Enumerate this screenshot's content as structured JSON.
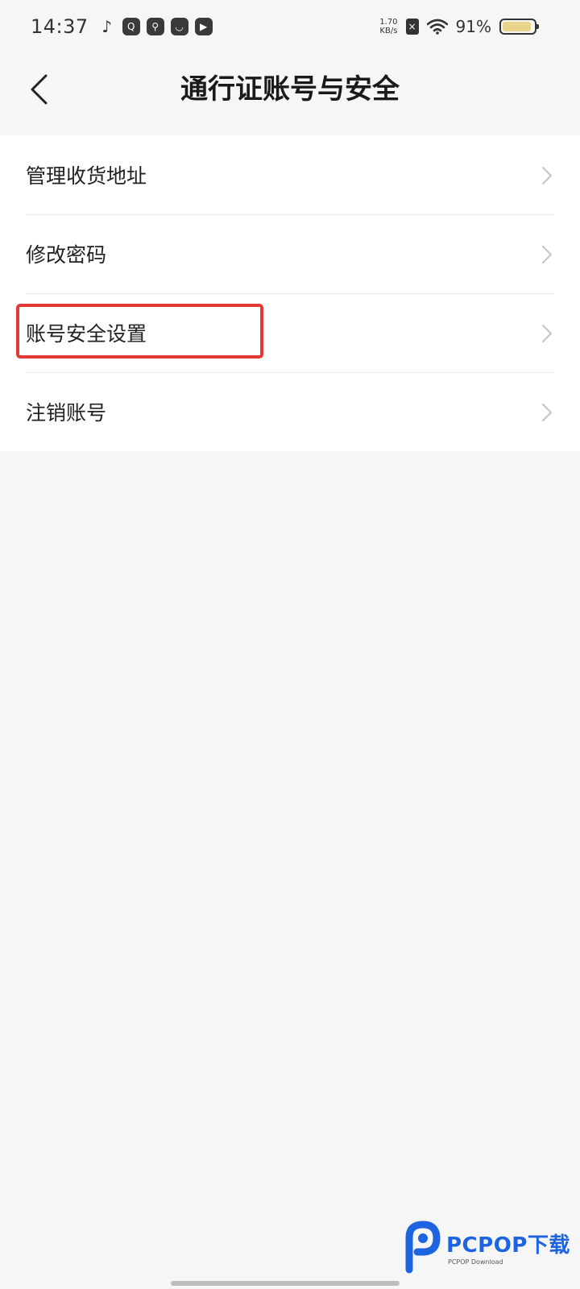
{
  "status_bar": {
    "time": "14:37",
    "app_icons": [
      "tiktok-icon",
      "q-browser-icon",
      "search-app-icon",
      "shopping-bag-icon",
      "play-icon"
    ],
    "net_speed_value": "1.70",
    "net_speed_unit": "KB/s",
    "battery_percent": "91%",
    "battery_level": 0.91
  },
  "header": {
    "title": "通行证账号与安全"
  },
  "menu": {
    "items": [
      {
        "label": "管理收货地址"
      },
      {
        "label": "修改密码"
      },
      {
        "label": "账号安全设置"
      },
      {
        "label": "注销账号"
      }
    ],
    "highlight_color": "#e53935"
  },
  "watermark": {
    "main": "PCPOP下载",
    "sub": "PCPOP Download"
  }
}
